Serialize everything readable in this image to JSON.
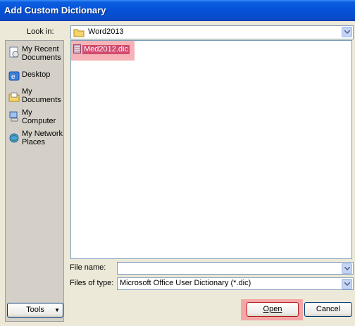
{
  "window": {
    "title": "Add Custom Dictionary"
  },
  "look_in": {
    "label": "Look in:",
    "value": "Word2013"
  },
  "places": [
    {
      "label": "My Recent Documents",
      "icon": "recent-documents-icon"
    },
    {
      "label": "Desktop",
      "icon": "desktop-icon"
    },
    {
      "label": "My Documents",
      "icon": "my-documents-icon"
    },
    {
      "label": "My Computer",
      "icon": "my-computer-icon"
    },
    {
      "label": "My Network Places",
      "icon": "network-places-icon"
    }
  ],
  "files": [
    {
      "name": "Med2012.dic",
      "icon": "dictionary-file-icon",
      "selected": true
    }
  ],
  "file_name": {
    "label": "File name:",
    "value": ""
  },
  "file_type": {
    "label": "Files of type:",
    "value": "Microsoft Office User Dictionary (*.dic)"
  },
  "buttons": {
    "tools": "Tools",
    "open": "Open",
    "cancel": "Cancel"
  },
  "colors": {
    "title_bar": "#0551d8",
    "highlight": "#f5a6a6",
    "selection": "#d24a6e"
  }
}
